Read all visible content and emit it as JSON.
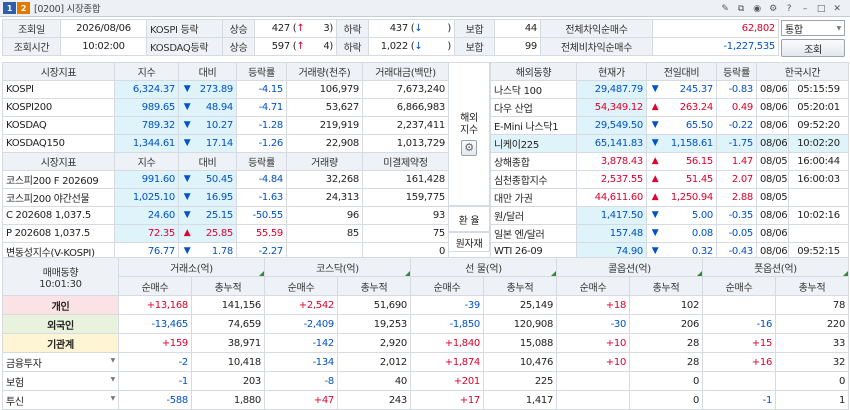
{
  "window": {
    "num": "1",
    "num2": "2",
    "title": "[0200] 시장종합"
  },
  "top": {
    "row1": {
      "l1": "조회일",
      "date": "2026/08/06",
      "k1": "KOSPI 등락",
      "up_l": "상승",
      "up_v": "427",
      "up_s": "3",
      "dn_l": "하락",
      "dn_v": "437",
      "dn_s": "",
      "flat_l": "보합",
      "flat_v": "44",
      "net_l": "전체차익순매수",
      "net_v": "62,802",
      "sel": "통합"
    },
    "row2": {
      "l1": "조회시간",
      "time": "10:02:00",
      "k1": "KOSDAQ등락",
      "up_l": "상승",
      "up_v": "597",
      "up_s": "4",
      "dn_l": "하락",
      "dn_v": "1,022",
      "dn_s": "",
      "flat_l": "보합",
      "flat_v": "99",
      "net_l": "전체비차익순매수",
      "net_v": "-1,227,535",
      "btn": "조회"
    }
  },
  "idx": {
    "h": [
      "시장지표",
      "지수",
      "대비",
      "등락률",
      "거래량(천주)",
      "거래대금(백만)"
    ],
    "rows": [
      [
        "KOSPI",
        "6,324.37",
        "▼",
        "273.89",
        "-4.15",
        "106,979",
        "7,673,240"
      ],
      [
        "KOSPI200",
        "989.65",
        "▼",
        "48.94",
        "-4.71",
        "53,627",
        "6,866,983"
      ],
      [
        "KOSDAQ",
        "789.32",
        "▼",
        "10.27",
        "-1.28",
        "219,919",
        "2,237,411"
      ],
      [
        "KOSDAQ150",
        "1,344.61",
        "▼",
        "17.14",
        "-1.26",
        "22,908",
        "1,013,729"
      ]
    ],
    "h2": [
      "시장지표",
      "지수",
      "대비",
      "등락률",
      "거래량",
      "미결제약정"
    ],
    "rows2": [
      [
        "코스피200 F 202609",
        "991.60",
        "▼",
        "50.45",
        "-4.84",
        "32,268",
        "161,428"
      ],
      [
        "코스피200 야간선물",
        "1,025.10",
        "▼",
        "16.95",
        "-1.63",
        "24,313",
        "159,775"
      ],
      [
        "C 202608 1,037.5",
        "24.60",
        "▼",
        "25.15",
        "-50.55",
        "96",
        "93"
      ],
      [
        "P 202608 1,037.5",
        "72.35",
        "▲",
        "25.85",
        "55.59",
        "85",
        "75"
      ],
      [
        "변동성지수(V-KOSPI)",
        "76.77",
        "▼",
        "1.78",
        "-2.27",
        "",
        "0"
      ]
    ]
  },
  "world": {
    "side1": "해외\n지수",
    "side2": "환 율",
    "side3": "원자재",
    "h": [
      "해외동향",
      "현재가",
      "전일대비",
      "등락률",
      "한국시간"
    ],
    "rows": [
      [
        "나스닥 100",
        "29,487.79",
        "▼",
        "245.37",
        "-0.83",
        "08/06",
        "05:15:59"
      ],
      [
        "다우 산업",
        "54,349.12",
        "▲",
        "263.24",
        "0.49",
        "08/06",
        "05:20:01"
      ],
      [
        "E-Mini 나스닥1",
        "29,549.50",
        "▼",
        "65.50",
        "-0.22",
        "08/06",
        "09:52:20"
      ],
      [
        "니케이225",
        "65,141.83",
        "▼",
        "1,158.61",
        "-1.75",
        "08/06",
        "10:02:20"
      ],
      [
        "상해종합",
        "3,878.43",
        "▲",
        "56.15",
        "1.47",
        "08/05",
        "16:00:44"
      ],
      [
        "심천종합지수",
        "2,537.55",
        "▲",
        "51.45",
        "2.07",
        "08/05",
        "16:00:03"
      ],
      [
        "대만 가권",
        "44,611.60",
        "▲",
        "1,250.94",
        "2.88",
        "08/05",
        ""
      ],
      [
        "원/달러",
        "1,417.50",
        "▼",
        "5.00",
        "-0.35",
        "08/06",
        "10:02:16"
      ],
      [
        "일본 엔/달러",
        "157.48",
        "▼",
        "0.08",
        "-0.05",
        "08/06",
        ""
      ],
      [
        "WTI 26-09",
        "74.90",
        "▼",
        "0.32",
        "-0.43",
        "08/06",
        "09:52:15"
      ]
    ]
  },
  "trade": {
    "h_main": "매매동향",
    "h_time": "10:01:30",
    "groups": [
      "거래소(억)",
      "코스닥(억)",
      "선 물(억)",
      "콜옵션(억)",
      "풋옵션(억)"
    ],
    "sub": [
      "순매수",
      "총누적"
    ],
    "rows": [
      {
        "name": "개인",
        "v": [
          "+13,168",
          "141,156",
          "+2,542",
          "51,690",
          "-39",
          "25,149",
          "+18",
          "102",
          "",
          "78"
        ]
      },
      {
        "name": "외국인",
        "v": [
          "-13,465",
          "74,659",
          "-2,409",
          "19,253",
          "-1,850",
          "120,908",
          "-30",
          "206",
          "-16",
          "220"
        ]
      },
      {
        "name": "기관계",
        "v": [
          "+159",
          "38,971",
          "-142",
          "2,920",
          "+1,840",
          "15,088",
          "+10",
          "28",
          "+15",
          "33"
        ]
      },
      {
        "name": "금융투자",
        "v": [
          "-2",
          "10,418",
          "-134",
          "2,012",
          "+1,874",
          "10,476",
          "+10",
          "28",
          "+16",
          "32"
        ]
      },
      {
        "name": "보험",
        "v": [
          "-1",
          "203",
          "-8",
          "40",
          "+201",
          "225",
          "",
          "0",
          "",
          "0"
        ]
      },
      {
        "name": "투신",
        "v": [
          "-588",
          "1,880",
          "+47",
          "243",
          "+17",
          "1,417",
          "",
          "0",
          "-1",
          "1"
        ]
      }
    ]
  },
  "colors": {
    "up": "#e0002b",
    "down": "#0052c8",
    "highlight": "#dff3fb"
  }
}
